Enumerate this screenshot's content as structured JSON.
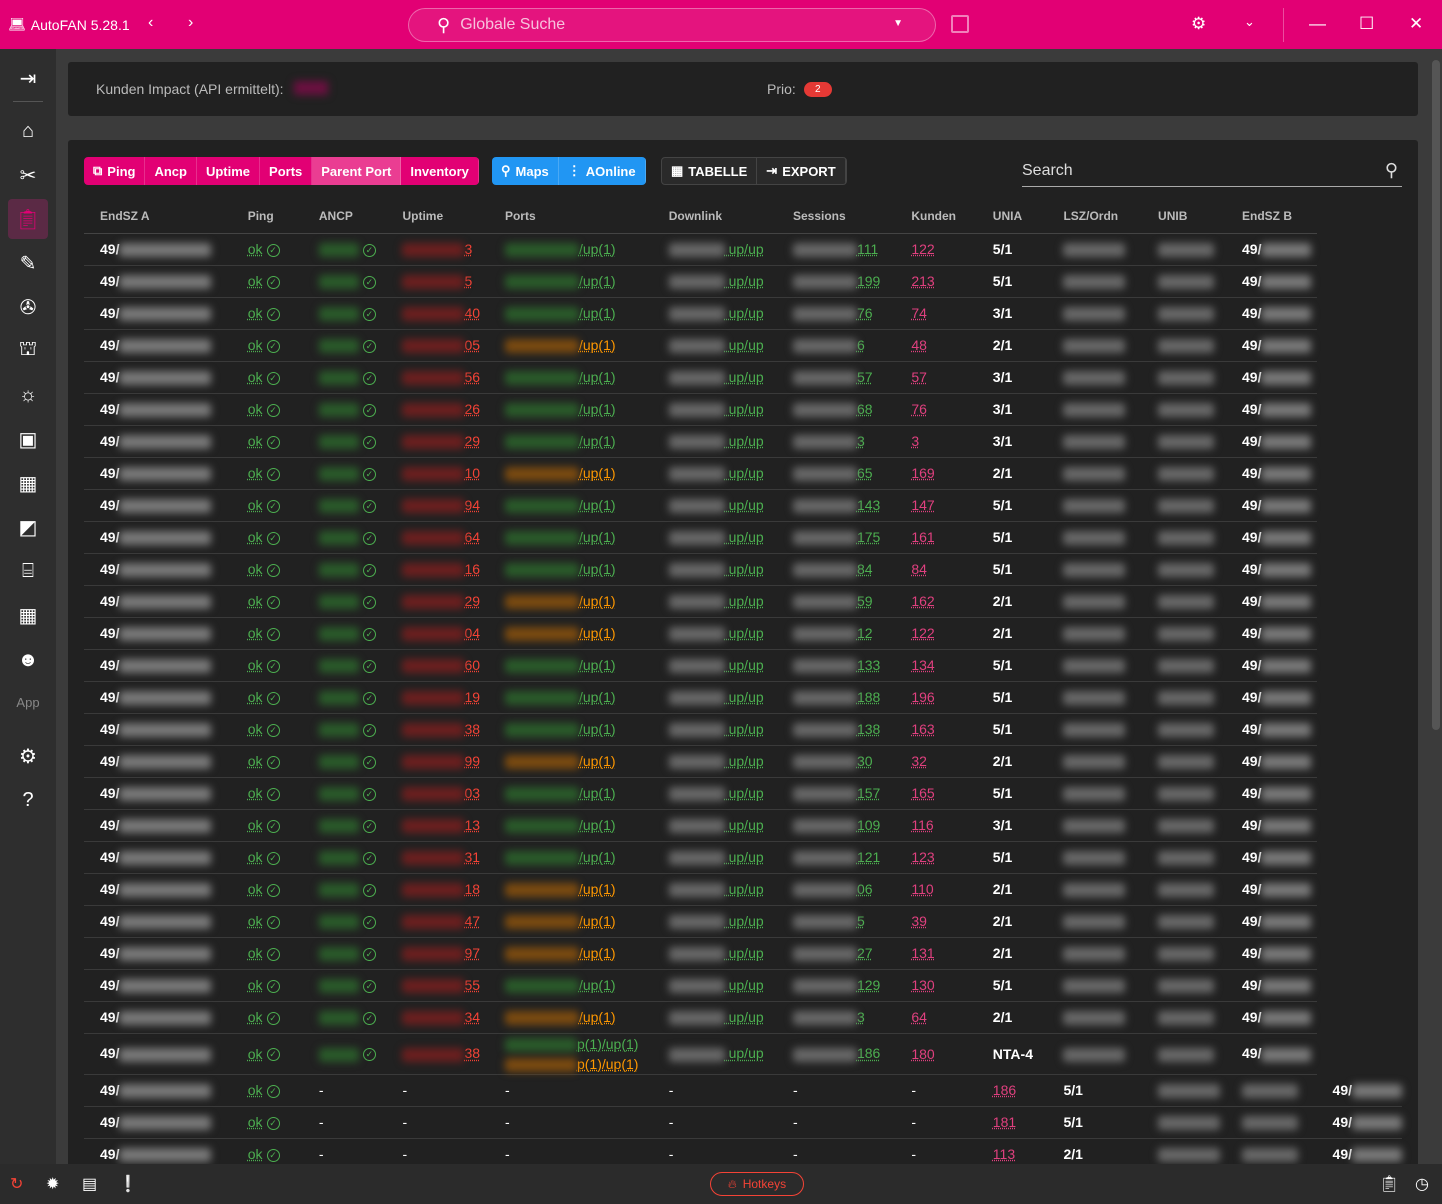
{
  "app": {
    "title": "AutoFAN 5.28.1",
    "search_placeholder": "Globale Suche"
  },
  "colors": {
    "brand": "#e20074",
    "accent_blue": "#2196f3",
    "ok": "#4caf50",
    "warn": "#ff9800",
    "error": "#f44336"
  },
  "sidebar": {
    "app_label": "App",
    "items": [
      "collapse-icon",
      "home-icon",
      "tools-icon",
      "clipboard-icon",
      "pencil-ruler-icon",
      "compass-icon",
      "crane-icon",
      "alarm-light-icon",
      "card-icon",
      "ticket-icon",
      "cards-icon",
      "router-icon",
      "calendar-icon",
      "robot-icon",
      "settings-icon",
      "help-icon"
    ]
  },
  "impact": {
    "label": "Kunden Impact (API ermittelt):",
    "prio_label": "Prio:",
    "prio_value": "2"
  },
  "toolbar": {
    "group1": [
      "Ping",
      "Ancp",
      "Uptime",
      "Ports",
      "Parent Port",
      "Inventory"
    ],
    "selected": "Parent Port",
    "group2": [
      "Maps",
      "AOnline"
    ],
    "group3": [
      "TABELLE",
      "EXPORT"
    ],
    "search_label": "Search"
  },
  "table": {
    "columns": [
      "EndSZ A",
      "Ping",
      "ANCP",
      "Uptime",
      "Ports",
      "Downlink",
      "Sessions",
      "Kunden",
      "UNIA",
      "LSZ/Ordn",
      "UNIB",
      "EndSZ B"
    ],
    "endsz_prefix": "49/",
    "ping_text": "ok",
    "ports_suffix": "/up(1)",
    "downlink_text": "up/up",
    "empty": "-",
    "rows": [
      {
        "uptime": "3",
        "ports_status": "green",
        "sessions": "111",
        "kunden": "122",
        "unia": "5/1"
      },
      {
        "uptime": "5",
        "ports_status": "green",
        "sessions": "199",
        "kunden": "213",
        "unia": "5/1"
      },
      {
        "uptime": "40",
        "ports_status": "green",
        "sessions": "76",
        "kunden": "74",
        "unia": "3/1"
      },
      {
        "uptime": "05",
        "ports_status": "orange",
        "sessions": "6",
        "kunden": "48",
        "unia": "2/1"
      },
      {
        "uptime": "56",
        "ports_status": "green",
        "sessions": "57",
        "kunden": "57",
        "unia": "3/1"
      },
      {
        "uptime": "26",
        "ports_status": "green",
        "sessions": "68",
        "kunden": "76",
        "unia": "3/1"
      },
      {
        "uptime": "29",
        "ports_status": "green",
        "sessions": "3",
        "kunden": "3",
        "unia": "3/1"
      },
      {
        "uptime": "10",
        "ports_status": "orange",
        "sessions": "65",
        "kunden": "169",
        "unia": "2/1"
      },
      {
        "uptime": "94",
        "ports_status": "green",
        "sessions": "143",
        "kunden": "147",
        "unia": "5/1"
      },
      {
        "uptime": "64",
        "ports_status": "green",
        "sessions": "175",
        "kunden": "161",
        "unia": "5/1"
      },
      {
        "uptime": "16",
        "ports_status": "green",
        "sessions": "84",
        "kunden": "84",
        "unia": "5/1"
      },
      {
        "uptime": "29",
        "ports_status": "orange",
        "sessions": "59",
        "kunden": "162",
        "unia": "2/1"
      },
      {
        "uptime": "04",
        "ports_status": "orange",
        "sessions": "12",
        "kunden": "122",
        "unia": "2/1"
      },
      {
        "uptime": "60",
        "ports_status": "green",
        "sessions": "133",
        "kunden": "134",
        "unia": "5/1"
      },
      {
        "uptime": "19",
        "ports_status": "green",
        "sessions": "188",
        "kunden": "196",
        "unia": "5/1"
      },
      {
        "uptime": "38",
        "ports_status": "green",
        "sessions": "138",
        "kunden": "163",
        "unia": "5/1"
      },
      {
        "uptime": "99",
        "ports_status": "orange",
        "sessions": "30",
        "kunden": "32",
        "unia": "2/1"
      },
      {
        "uptime": "03",
        "ports_status": "green",
        "sessions": "157",
        "kunden": "165",
        "unia": "5/1"
      },
      {
        "uptime": "13",
        "ports_status": "green",
        "sessions": "109",
        "kunden": "116",
        "unia": "3/1"
      },
      {
        "uptime": "31",
        "ports_status": "green",
        "sessions": "121",
        "kunden": "123",
        "unia": "5/1"
      },
      {
        "uptime": "18",
        "ports_status": "orange",
        "sessions": "06",
        "kunden": "110",
        "unia": "2/1"
      },
      {
        "uptime": "47",
        "ports_status": "orange",
        "sessions": "5",
        "kunden": "39",
        "unia": "2/1"
      },
      {
        "uptime": "97",
        "ports_status": "orange",
        "sessions": "27",
        "kunden": "131",
        "unia": "2/1"
      },
      {
        "uptime": "55",
        "ports_status": "green",
        "sessions": "129",
        "kunden": "130",
        "unia": "5/1"
      },
      {
        "uptime": "34",
        "ports_status": "orange",
        "sessions": "3",
        "kunden": "64",
        "unia": "2/1"
      },
      {
        "uptime": "38",
        "ports_status": "multi",
        "ports_lines": [
          "p(1)/up(1)",
          "p(1)/up(1)"
        ],
        "sessions": "186",
        "kunden": "180",
        "unia": "NTA-4"
      },
      {
        "empty": true,
        "kunden": "186",
        "unia": "5/1"
      },
      {
        "empty": true,
        "kunden": "181",
        "unia": "5/1"
      },
      {
        "empty": true,
        "kunden": "113",
        "unia": "2/1"
      }
    ]
  },
  "bottombar": {
    "hotkeys_label": "Hotkeys"
  }
}
